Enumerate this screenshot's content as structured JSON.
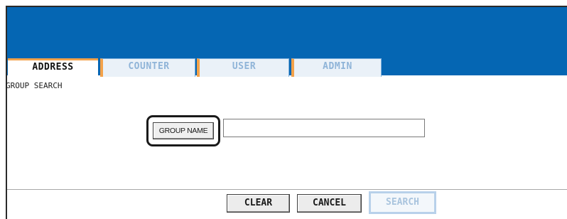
{
  "tabs": [
    {
      "label": "ADDRESS",
      "active": true
    },
    {
      "label": "COUNTER",
      "active": false
    },
    {
      "label": "USER",
      "active": false
    },
    {
      "label": "ADMIN",
      "active": false
    }
  ],
  "section": {
    "title": "GROUP SEARCH"
  },
  "group_name": {
    "button_label": "GROUP NAME",
    "value": ""
  },
  "footer": {
    "clear_label": "CLEAR",
    "cancel_label": "CANCEL",
    "search_label": "SEARCH"
  },
  "colors": {
    "header": "#0566b3",
    "tab_accent": "#f3a24a",
    "inactive_text": "#8fb4d8"
  }
}
